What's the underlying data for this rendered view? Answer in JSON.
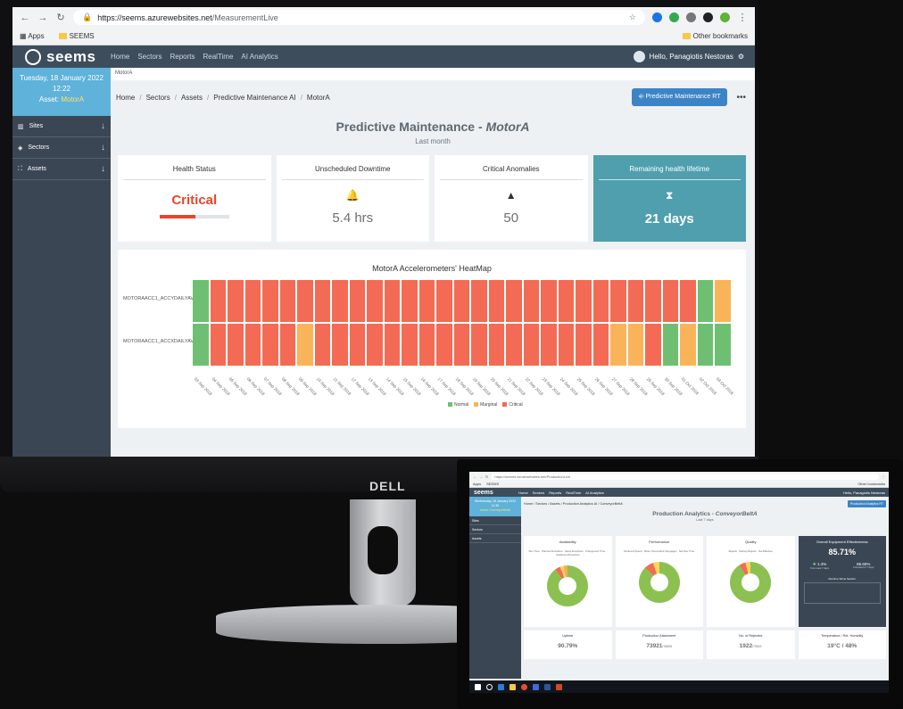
{
  "browser": {
    "url_host": "https://seems.azurewebsites.net",
    "url_path": "/MeasurementLive",
    "bookmarks": [
      "Apps",
      "SEEMS"
    ],
    "other_bookmarks": "Other bookmarks"
  },
  "topnav": {
    "logo": "seems",
    "links": [
      "Home",
      "Sectors",
      "Reports",
      "RealTime",
      "AI Analytics"
    ],
    "user_greeting": "Hello, Panagiotis Nestoras"
  },
  "sidebar": {
    "date": "Tuesday, 18 January 2022",
    "time": "12:22",
    "asset_label": "Asset:",
    "asset_name": "MotorA",
    "items": [
      {
        "label": "Sites"
      },
      {
        "label": "Sectors"
      },
      {
        "label": "Assets"
      }
    ]
  },
  "main": {
    "asset_bar": "MotorA",
    "breadcrumb": [
      "Home",
      "Sectors",
      "Assets",
      "Predictive Maintenance AI",
      "MotorA"
    ],
    "rt_button": "Predictive Maintenance RT",
    "more": "•••",
    "title": "Predictive Maintenance - ",
    "title_asset": "MotorA",
    "subtitle": "Last month"
  },
  "cards": [
    {
      "title": "Health Status",
      "value": "Critical",
      "bar_fraction": 0.52
    },
    {
      "title": "Unscheduled Downtime",
      "icon": "bell-icon",
      "value": "5.4 hrs"
    },
    {
      "title": "Critical Anomalies",
      "icon": "warning-icon",
      "value": "50"
    },
    {
      "title": "Remaining health lifetime",
      "icon": "hourglass-icon",
      "value": "21 days"
    }
  ],
  "colors": {
    "normal": "#6fbf73",
    "marginal": "#f9b459",
    "critical": "#f36b54",
    "accent": "#3d84c6",
    "teal": "#4f9fae"
  },
  "chart_data": {
    "type": "heatmap",
    "title": "MotorA Accelerometers' HeatMap",
    "rows": [
      "MOTORAACC1_ACCYDAILYAVG",
      "MOTORAACC1_ACCXDAILYAVG"
    ],
    "x": [
      "03 Sep 2018",
      "04 Sep 2018",
      "05 Sep 2018",
      "06 Sep 2018",
      "07 Sep 2018",
      "08 Sep 2018",
      "09 Sep 2018",
      "10 Sep 2018",
      "11 Sep 2018",
      "12 Sep 2018",
      "13 Sep 2018",
      "14 Sep 2018",
      "15 Sep 2018",
      "16 Sep 2018",
      "17 Sep 2018",
      "18 Sep 2018",
      "19 Sep 2018",
      "20 Sep 2018",
      "21 Sep 2018",
      "22 Sep 2018",
      "23 Sep 2018",
      "24 Sep 2018",
      "25 Sep 2018",
      "26 Sep 2018",
      "27 Sep 2018",
      "28 Sep 2018",
      "29 Sep 2018",
      "30 Sep 2018",
      "01 Oct 2018",
      "02 Oct 2018",
      "03 Oct 2018"
    ],
    "values": [
      [
        "N",
        "C",
        "C",
        "C",
        "C",
        "C",
        "C",
        "C",
        "C",
        "C",
        "C",
        "C",
        "C",
        "C",
        "C",
        "C",
        "C",
        "C",
        "C",
        "C",
        "C",
        "C",
        "C",
        "C",
        "C",
        "C",
        "C",
        "C",
        "C",
        "N",
        "M"
      ],
      [
        "N",
        "C",
        "C",
        "C",
        "C",
        "C",
        "M",
        "C",
        "C",
        "C",
        "C",
        "C",
        "C",
        "C",
        "C",
        "C",
        "C",
        "C",
        "C",
        "C",
        "C",
        "C",
        "C",
        "C",
        "M",
        "M",
        "C",
        "N",
        "M",
        "N",
        "N"
      ]
    ],
    "legend": [
      "Normal",
      "Marginal",
      "Critical"
    ]
  },
  "laptop": {
    "url": "https://seems.azurewebsites.net/ProductionLive",
    "bookmarks": [
      "Apps",
      "SEEMS"
    ],
    "other_bookmarks": "Other bookmarks",
    "logo": "seems",
    "links": [
      "Home",
      "Sectors",
      "Reports",
      "RealTime",
      "AI Analytics"
    ],
    "user_greeting": "Hello, Panagiotis Nestoras",
    "date": "Wednesday, 18 January 2022",
    "time": "11:30",
    "asset_name": "Asset: ConveyorBeltA",
    "side_items": [
      "Sites",
      "Sectors",
      "Assets"
    ],
    "breadcrumb": "Home  /  Sectors  /  Assets  /  Production Analytics AI  /  ConveyorBeltA",
    "rt_button": "Production Analytics RT",
    "title": "Production Analytics - ",
    "title_asset": "ConveyorBeltA",
    "subtitle": "Last 7 days",
    "donuts": [
      {
        "title": "Availability",
        "legend": "Run Time · Planned Downtime · Setup Downtime · Changeover Time · Unplanned Downtime",
        "slices": [
          0.9,
          0.04,
          0.03,
          0.03
        ]
      },
      {
        "title": "Performance",
        "legend": "Reduced Speed · Minor Unrecorded Stoppages · Net Run Time",
        "slices": [
          0.88,
          0.07,
          0.05
        ]
      },
      {
        "title": "Quality",
        "legend": "Rejects · Startup Rejects · Net Effective",
        "slices": [
          0.91,
          0.05,
          0.04
        ]
      }
    ],
    "oee": {
      "title": "Overall Equipment Effectiveness",
      "value": "85.71%",
      "delta": "1.4%",
      "delta_label": "From Last 7 days",
      "target": "86.65%",
      "target_label": "Forecast for 7 days",
      "trend_label": "Runtime Shine Section"
    },
    "bottom_cards": [
      {
        "title": "Uptime",
        "value": "90.79%",
        "suffix": ""
      },
      {
        "title": "Production Attainment",
        "value": "73921",
        "suffix": "/76595"
      },
      {
        "title": "No. of Rejected",
        "value": "1922",
        "suffix": "/73921"
      },
      {
        "title": "Temperature / Rel. Humidity",
        "value": "19°C / 48%",
        "suffix": ""
      }
    ]
  },
  "monitor_brand": "DELL"
}
